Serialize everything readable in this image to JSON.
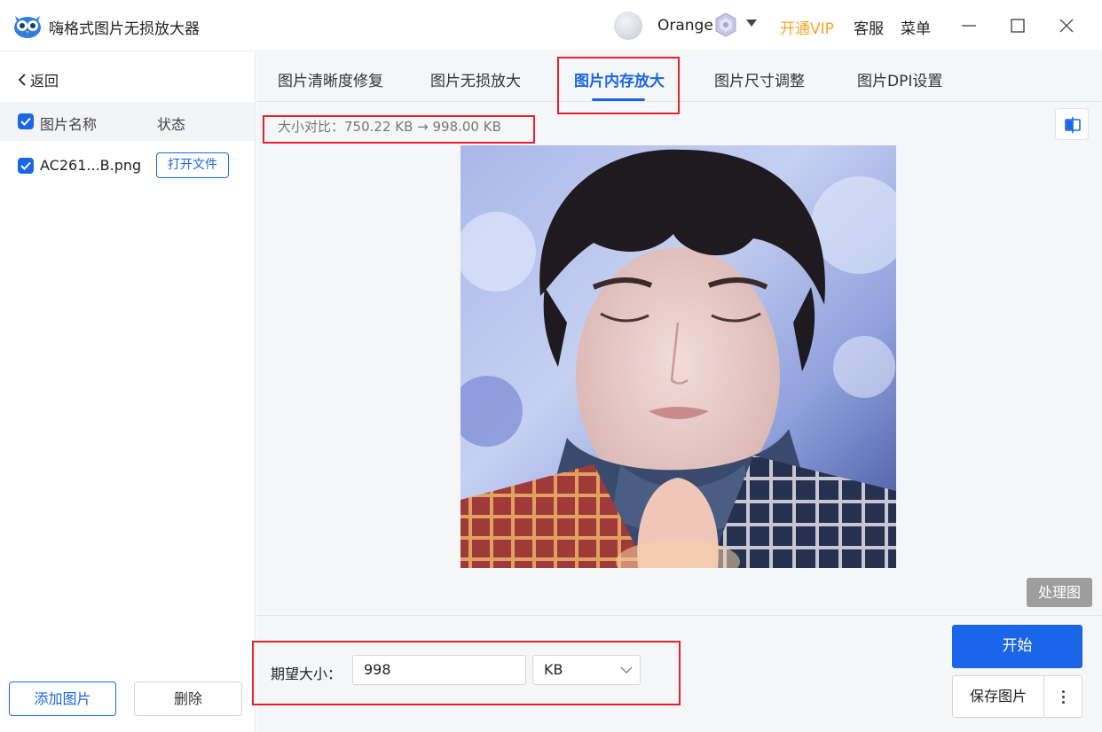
{
  "app": {
    "title": "嗨格式图片无损放大器",
    "logo_icon": "owl-logo-icon"
  },
  "header": {
    "username": "Orange",
    "vip_label": "开通VIP",
    "service_label": "客服",
    "menu_label": "菜单",
    "vip_color": "#f5a623"
  },
  "sidebar": {
    "back_label": "返回",
    "list_header": {
      "name": "图片名称",
      "status": "状态"
    },
    "files": [
      {
        "name": "AC261...B.png",
        "action": "打开文件",
        "checked": true
      }
    ],
    "add_label": "添加图片",
    "delete_label": "删除"
  },
  "tabs": [
    {
      "label": "图片清晰度修复",
      "active": false
    },
    {
      "label": "图片无损放大",
      "active": false
    },
    {
      "label": "图片内存放大",
      "active": true
    },
    {
      "label": "图片尺寸调整",
      "active": false
    },
    {
      "label": "图片DPI设置",
      "active": false
    }
  ],
  "main": {
    "size_compare": "大小对比：750.22 KB → 998.00 KB",
    "processed_tag": "处理图",
    "expect_label": "期望大小：",
    "expect_value": "998",
    "unit": "KB",
    "start_label": "开始",
    "save_label": "保存图片"
  },
  "colors": {
    "accent": "#1b66e8",
    "highlight_box": "#e8202a"
  }
}
